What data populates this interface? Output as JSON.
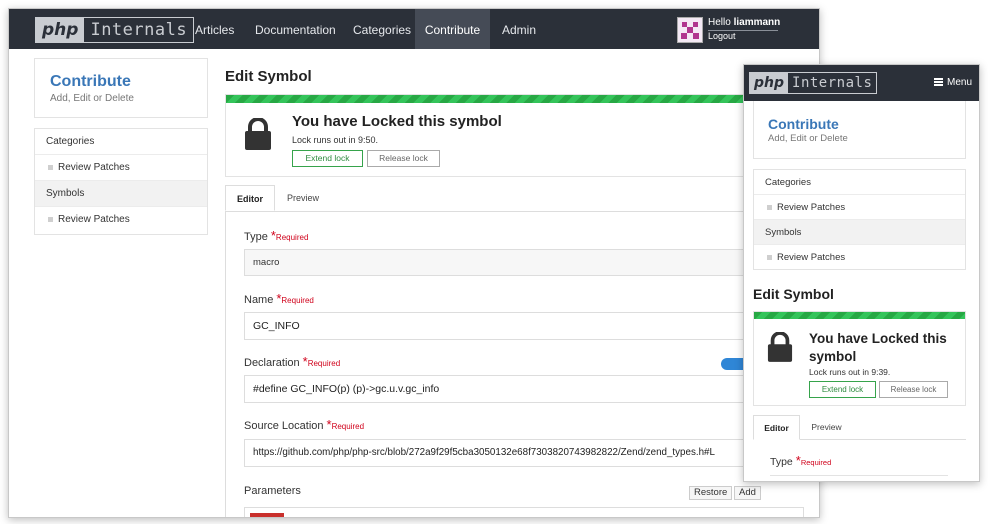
{
  "brand": {
    "php": "php",
    "internals": "Internals"
  },
  "nav": {
    "items": [
      "Articles",
      "Documentation",
      "Categories",
      "Contribute",
      "Admin"
    ],
    "active": "Contribute",
    "hello_prefix": "Hello",
    "username": "liammann",
    "logout": "Logout"
  },
  "sidebar": {
    "title": "Contribute",
    "subtitle": "Add, Edit or Delete",
    "items": [
      {
        "label": "Categories",
        "type": "section"
      },
      {
        "label": "Review Patches",
        "type": "sub"
      },
      {
        "label": "Symbols",
        "type": "section"
      },
      {
        "label": "Review Patches",
        "type": "sub"
      }
    ]
  },
  "page_title": "Edit Symbol",
  "lock": {
    "title": "You have Locked this symbol",
    "runs_out": "Lock runs out in 9:50.",
    "extend": "Extend lock",
    "release": "Release lock"
  },
  "tabs": [
    "Editor",
    "Preview"
  ],
  "required_text": "Required",
  "form": {
    "type": {
      "label": "Type",
      "value": "macro"
    },
    "name": {
      "label": "Name",
      "value": "GC_INFO"
    },
    "declaration": {
      "label": "Declaration",
      "value": "#define GC_INFO(p) (p)->gc.u.v.gc_info",
      "toggle_on": true
    },
    "source": {
      "label": "Source Location",
      "value": "https://github.com/php/php-src/blob/272a9f29f5cba3050132e68f7303820743982822/Zend/zend_types.h#L"
    },
    "parameters": {
      "label": "Parameters",
      "restore": "Restore",
      "add": "Add"
    }
  },
  "mobile": {
    "menu": "Menu",
    "title_line1": "You have Locked this",
    "title_line2": "symbol",
    "runs_out": "Lock runs out in 9:39."
  },
  "colors": {
    "nav_bg": "#2b3039",
    "accent": "#3a77b7",
    "lock_green": "#27a844",
    "required": "#d0021b",
    "toggle": "#2f86d6"
  }
}
